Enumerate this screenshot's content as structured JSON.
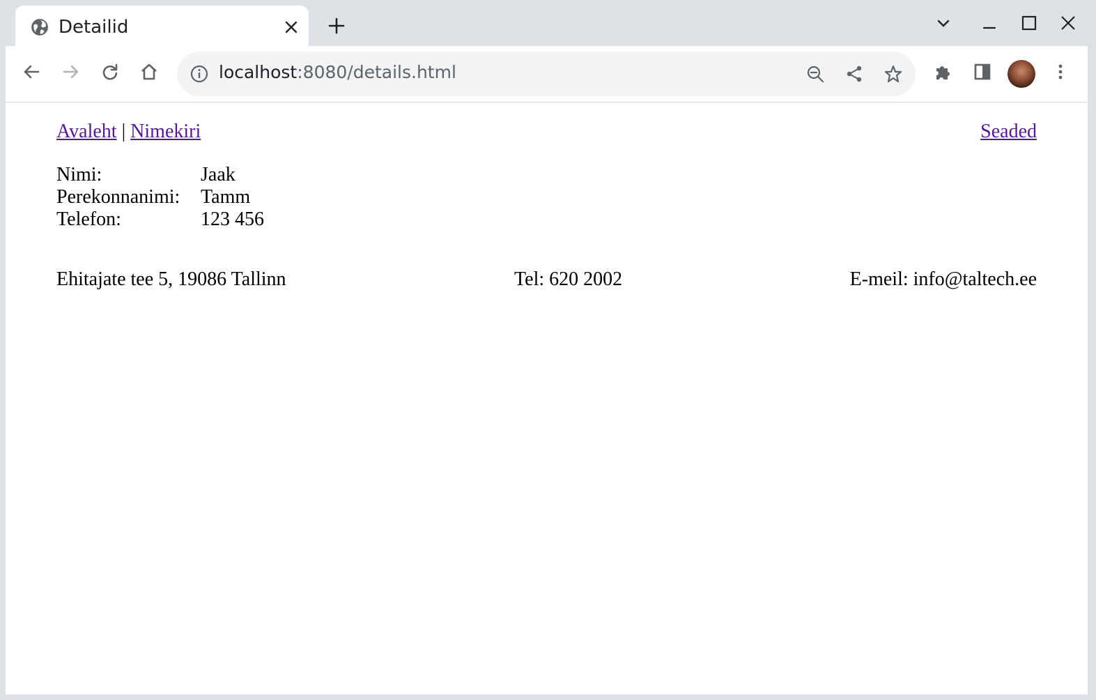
{
  "browser": {
    "tab_title": "Detailid",
    "url_host": "localhost",
    "url_rest": ":8080/details.html"
  },
  "nav": {
    "home_link": "Avaleht",
    "separator": "|",
    "list_link": "Nimekiri",
    "settings_link": "Seaded"
  },
  "details": {
    "rows": [
      {
        "label": "Nimi:",
        "value": "Jaak"
      },
      {
        "label": "Perekonnanimi:",
        "value": "Tamm"
      },
      {
        "label": "Telefon:",
        "value": "123 456"
      }
    ]
  },
  "footer": {
    "address": "Ehitajate tee 5, 19086 Tallinn",
    "phone": "Tel: 620 2002",
    "email": "E-meil: info@taltech.ee"
  },
  "colors": {
    "link": "#551a8b",
    "chrome_bg": "#dee1e6",
    "omnibox_bg": "#f1f3f4"
  }
}
